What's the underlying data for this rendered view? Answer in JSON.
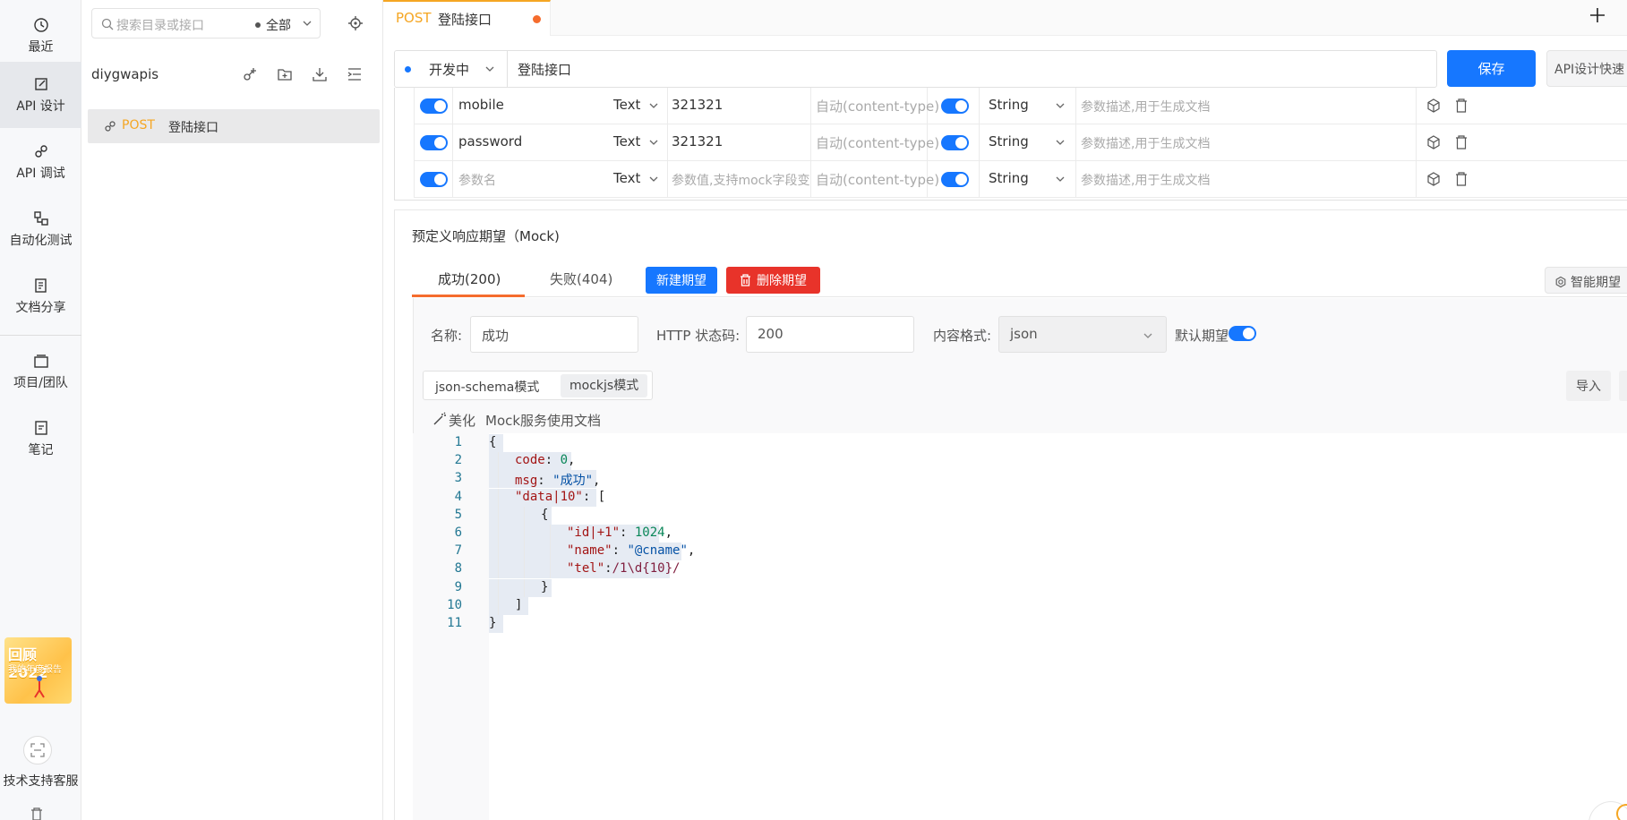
{
  "rail": {
    "items": [
      {
        "label": "最近",
        "icon": "history-icon"
      },
      {
        "label": "API 设计",
        "icon": "edit-doc-icon"
      },
      {
        "label": "API 调试",
        "icon": "link-icon"
      },
      {
        "label": "自动化测试",
        "icon": "flow-icon"
      },
      {
        "label": "文档分享",
        "icon": "share-doc-icon"
      },
      {
        "label": "项目/团队",
        "icon": "folders-icon"
      },
      {
        "label": "笔记",
        "icon": "note-icon"
      }
    ],
    "promo_year": "回顾2022",
    "promo_sub": "我的年度报告",
    "support_label": "技术支持客服"
  },
  "tree": {
    "search_placeholder": "搜索目录或接口",
    "scope": "全部",
    "project_name": "diygwapis",
    "item": {
      "method": "POST",
      "name": "登陆接口"
    }
  },
  "tabs": [
    {
      "method": "POST",
      "name": "登陆接口",
      "unsaved": true
    }
  ],
  "request": {
    "status": "开发中",
    "name": "登陆接口",
    "save_label": "保存",
    "fast_label": "API设计快速"
  },
  "params": [
    {
      "enabled": true,
      "name": "mobile",
      "name_placeholder": false,
      "type": "Text",
      "value": "321321",
      "value_placeholder": false,
      "content_type": "自动(content-type)",
      "required": true,
      "data_type": "String",
      "desc": "参数描述,用于生成文档"
    },
    {
      "enabled": true,
      "name": "password",
      "name_placeholder": false,
      "type": "Text",
      "value": "321321",
      "value_placeholder": false,
      "content_type": "自动(content-type)",
      "required": true,
      "data_type": "String",
      "desc": "参数描述,用于生成文档"
    },
    {
      "enabled": true,
      "name": "参数名",
      "name_placeholder": true,
      "type": "Text",
      "value": "参数值,支持mock字段变",
      "value_placeholder": true,
      "content_type": "自动(content-type)",
      "required": true,
      "data_type": "String",
      "desc": "参数描述,用于生成文档"
    }
  ],
  "mock": {
    "title": "预定义响应期望（Mock)",
    "tabs": [
      "成功(200)",
      "失败(404)"
    ],
    "active_tab": 0,
    "new_label": "新建期望",
    "delete_label": "删除期望",
    "smart_label": "智能期望",
    "name_label": "名称:",
    "name_value": "成功",
    "status_label": "HTTP 状态码:",
    "status_value": "200",
    "format_label": "内容格式:",
    "format_value": "json",
    "default_label": "默认期望",
    "default_on": true,
    "modes": [
      "json-schema模式",
      "mockjs模式"
    ],
    "active_mode": 1,
    "import_label": "导入",
    "beautify_label": "美化",
    "doc_label": "Mock服务使用文档"
  },
  "code_lines": [
    {
      "n": "1",
      "text": "{"
    },
    {
      "n": "2",
      "text": "code: 0,"
    },
    {
      "n": "3",
      "text": "msg: \"成功\","
    },
    {
      "n": "4",
      "text": "\"data|10\": ["
    },
    {
      "n": "5",
      "text": "{"
    },
    {
      "n": "6",
      "text": "\"id|+1\": 1024,"
    },
    {
      "n": "7",
      "text": "\"name\": \"@cname\","
    },
    {
      "n": "8",
      "text": "\"tel\":/1\\d{10}/"
    },
    {
      "n": "9",
      "text": "}"
    },
    {
      "n": "10",
      "text": "]"
    },
    {
      "n": "11",
      "text": "}"
    }
  ],
  "colors": {
    "accent": "#1677ff",
    "method": "#f5a623",
    "danger": "#e8332a",
    "tab_indicator": "#f56c2d"
  }
}
